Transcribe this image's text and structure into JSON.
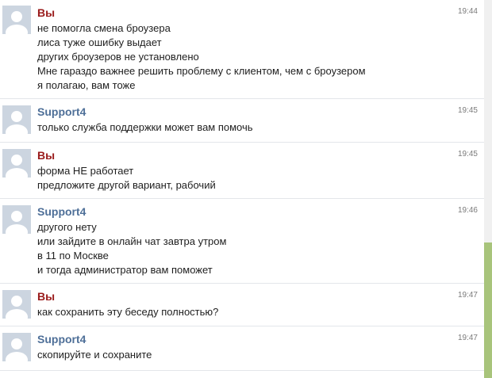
{
  "messages": [
    {
      "sender": "Вы",
      "role": "self",
      "time": "19:44",
      "lines": [
        "не помогла смена броузера",
        "лиса туже ошибку выдает",
        "других броузеров не установлено",
        "Мне гараздо важнее решить проблему с клиентом, чем с броузером",
        "я полагаю, вам тоже"
      ]
    },
    {
      "sender": "Support4",
      "role": "support",
      "time": "19:45",
      "lines": [
        "только служба поддержки может вам помочь"
      ]
    },
    {
      "sender": "Вы",
      "role": "self",
      "time": "19:45",
      "lines": [
        "форма НЕ работает",
        "предложите другой вариант, рабочий"
      ]
    },
    {
      "sender": "Support4",
      "role": "support",
      "time": "19:46",
      "lines": [
        "другого нету",
        "или зайдите в онлайн чат завтра утром",
        "в 11 по Москве",
        "и тогда администратор вам поможет"
      ]
    },
    {
      "sender": "Вы",
      "role": "self",
      "time": "19:47",
      "lines": [
        "как сохранить эту беседу полностью?"
      ]
    },
    {
      "sender": "Support4",
      "role": "support",
      "time": "19:47",
      "lines": [
        "скопируйте и сохраните"
      ]
    }
  ],
  "colors": {
    "self_name": "#9a1b1b",
    "support_name": "#4e6f98",
    "scrollbar_thumb": "#a8c47b",
    "avatar_bg": "#ccd5e0"
  },
  "scrollbar": {
    "position_fraction": 0.64
  }
}
